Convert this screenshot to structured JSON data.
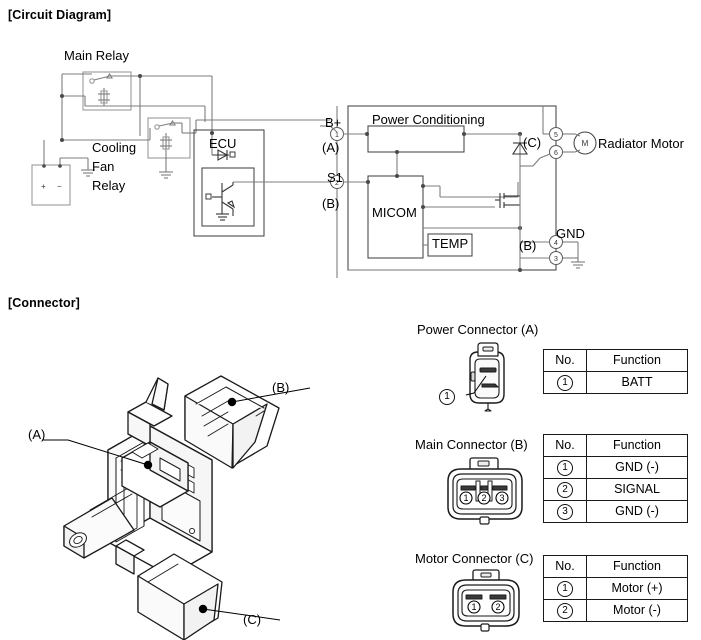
{
  "sections": {
    "circuit_title": "[Circuit Diagram]",
    "connector_title": "[Connector]"
  },
  "circuit": {
    "labels": {
      "main_relay": "Main Relay",
      "cooling_fan_relay_l1": "Cooling",
      "cooling_fan_relay_l2": "Fan",
      "cooling_fan_relay_l3": "Relay",
      "ecu": "ECU",
      "battery_plus": "+",
      "battery_minus": "-",
      "b_plus": "B+",
      "b_plus_conn": "(A)",
      "s1": "S1",
      "s1_conn": "(B)",
      "power_conditioning": "Power Conditioning",
      "micom": "MICOM",
      "temp": "TEMP",
      "motor_conn": "(C)",
      "motor_symbol": "M",
      "radiator_motor": "Radiator Motor",
      "gnd": "GND",
      "gnd_conn": "(B)"
    },
    "pins": {
      "b_plus": "1",
      "s1": "2",
      "motor_top": "5",
      "motor_bottom": "6",
      "gnd_top": "4",
      "gnd_bottom": "3"
    }
  },
  "connector_diagram": {
    "callouts": [
      {
        "id": "callout-a",
        "label": "(A)"
      },
      {
        "id": "callout-b",
        "label": "(B)"
      },
      {
        "id": "callout-c",
        "label": "(C)"
      }
    ]
  },
  "connectors": [
    {
      "id": "power-connector-a",
      "title": "Power Connector (A)",
      "pin_callout": "1",
      "columns": [
        "No.",
        "Function"
      ],
      "rows": [
        {
          "no": "1",
          "function": "BATT"
        }
      ],
      "pin_labels": [
        "1"
      ]
    },
    {
      "id": "main-connector-b",
      "title": "Main Connector (B)",
      "columns": [
        "No.",
        "Function"
      ],
      "rows": [
        {
          "no": "1",
          "function": "GND (-)"
        },
        {
          "no": "2",
          "function": "SIGNAL"
        },
        {
          "no": "3",
          "function": "GND (-)"
        }
      ],
      "pin_labels": [
        "1",
        "2",
        "3"
      ]
    },
    {
      "id": "motor-connector-c",
      "title": "Motor Connector (C)",
      "columns": [
        "No.",
        "Function"
      ],
      "rows": [
        {
          "no": "1",
          "function": "Motor (+)"
        },
        {
          "no": "2",
          "function": "Motor (-)"
        }
      ],
      "pin_labels": [
        "1",
        "2"
      ]
    }
  ],
  "colors": {
    "wire": "#7d7d7d",
    "ink": "#000000",
    "box": "#9a9a9a"
  }
}
